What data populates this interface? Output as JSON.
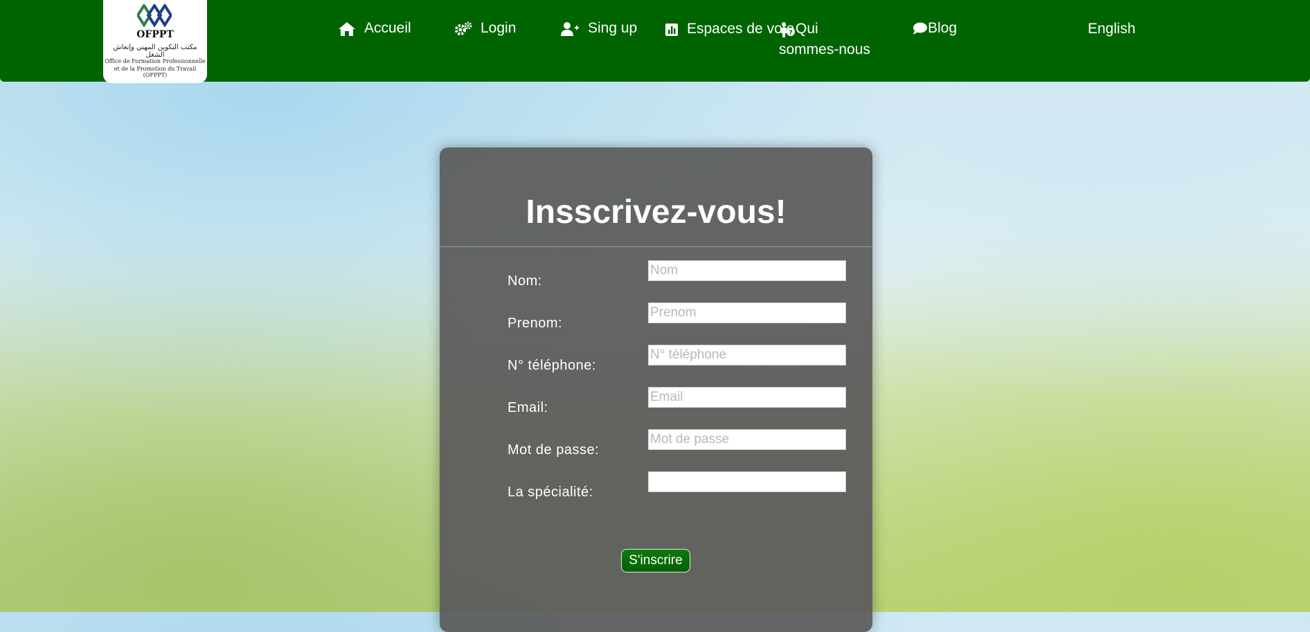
{
  "colors": {
    "navbar": "#006400",
    "card": "#5a5a5a",
    "button": "#0b7a0b"
  },
  "logo": {
    "brand": "OFPPT",
    "arabic": "مكتب التكوين المهني وإنعاش الشغل",
    "line1": "Office de Formation Professionnelle",
    "line2": "et de la Promotion du Travail (OFPPT)"
  },
  "nav": {
    "items": [
      {
        "label": "Accueil",
        "icon": "home-icon"
      },
      {
        "label": "Login",
        "icon": "gears-icon"
      },
      {
        "label": "Sing up",
        "icon": "user-plus-icon"
      },
      {
        "label_line1": "Espaces de",
        "label_line2": "vote",
        "icon": "poll-icon"
      },
      {
        "label_line1": "Qui",
        "label_line2": "sommes-nous",
        "icon": "person-question-icon"
      },
      {
        "label": "Blog",
        "icon": "comment-icon"
      }
    ],
    "language": "English"
  },
  "form": {
    "title": "Insscrivez-vous!",
    "fields": [
      {
        "label": "Nom:",
        "placeholder": "Nom",
        "value": ""
      },
      {
        "label": "Prenom:",
        "placeholder": "Prenom",
        "value": ""
      },
      {
        "label": "N° téléphone:",
        "placeholder": "N° téléphone",
        "value": ""
      },
      {
        "label": "Email:",
        "placeholder": "Email",
        "value": ""
      },
      {
        "label": "Mot de passe:",
        "placeholder": "Mot de passe",
        "value": ""
      },
      {
        "label": "La spécialité:",
        "placeholder": "",
        "value": ""
      }
    ],
    "submit_label": "S'inscrire"
  }
}
